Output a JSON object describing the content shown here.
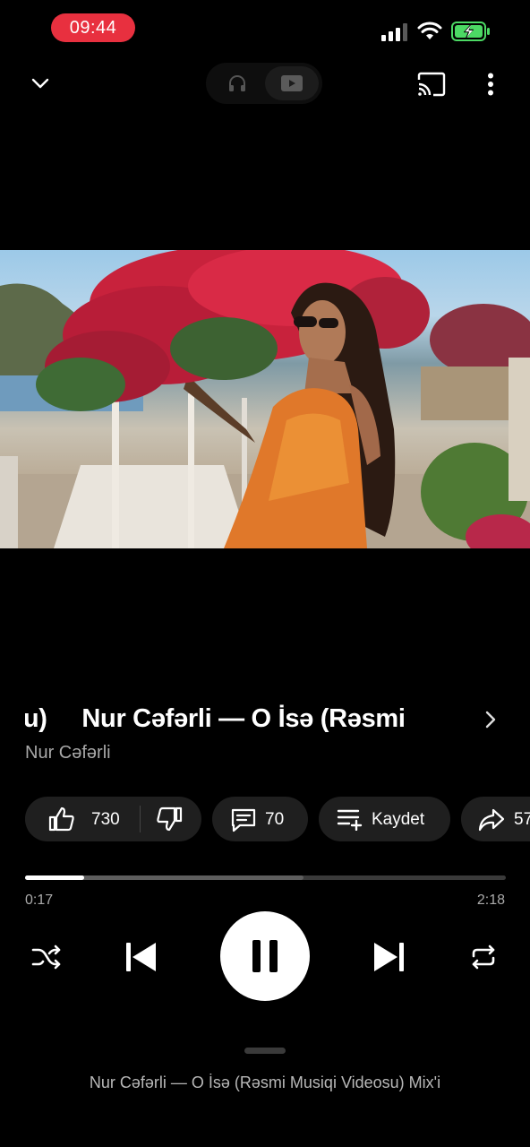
{
  "status_bar": {
    "time": "09:44",
    "icons": [
      "signal-icon",
      "wifi-icon",
      "battery-charging-icon"
    ],
    "time_pill_color": "#e8303f",
    "battery_color": "#4cd964"
  },
  "top_bar": {
    "icons": [
      "chevron-down-icon",
      "headphones-icon",
      "video-icon",
      "cast-icon",
      "more-vert-icon"
    ],
    "selected_mode": "video"
  },
  "player": {
    "title": "su)     Nur Cəfərli — O İsə (Rəsmi",
    "artist": "Nur Cəfərli",
    "current_time": "0:17",
    "total_time": "2:18",
    "progress": 0.123,
    "buffered": 0.58
  },
  "actions": {
    "likes": "730",
    "comments": "70",
    "save_label": "Kaydet",
    "share_label": "57"
  },
  "controls": {
    "icons": [
      "shuffle-icon",
      "previous-icon",
      "pause-icon",
      "next-icon",
      "repeat-icon"
    ]
  },
  "queue": {
    "title": "Nur Cəfərli — O İsə (Rəsmi Musiqi Videosu) Mix'i"
  }
}
